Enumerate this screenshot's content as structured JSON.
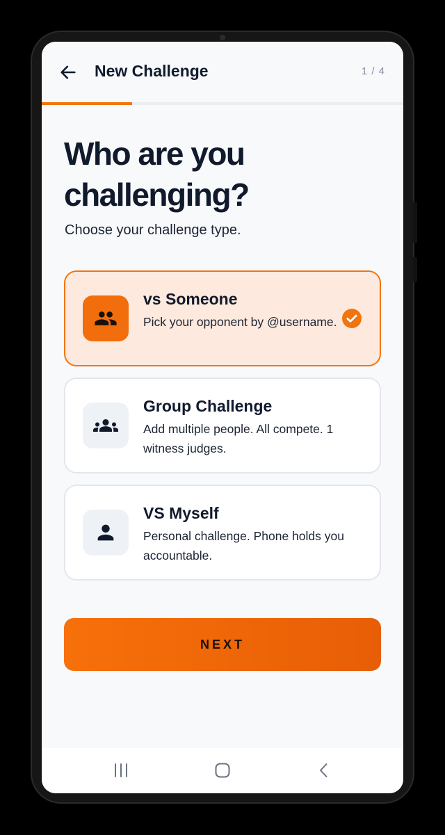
{
  "topbar": {
    "title": "New Challenge",
    "step": "1 / 4",
    "progress": 0.25
  },
  "headline": "Who are you challenging?",
  "subheadline": "Choose your challenge type.",
  "options": [
    {
      "title": "vs Someone",
      "description": "Pick your opponent by @username.",
      "icon": "people-icon",
      "selected": true
    },
    {
      "title": "Group Challenge",
      "description": "Add multiple people. All compete. 1 witness judges.",
      "icon": "group-icon",
      "selected": false
    },
    {
      "title": "VS Myself",
      "description": "Personal challenge. Phone holds you accountable.",
      "icon": "person-icon",
      "selected": false
    }
  ],
  "next_button": {
    "label": "NEXT"
  },
  "colors": {
    "accent": "#f0750f",
    "selected_bg": "#fde9dd",
    "text_primary": "#111a2c"
  },
  "system_nav": {
    "recents_icon": "recent-apps-icon",
    "home_icon": "home-icon",
    "back_icon": "back-icon"
  }
}
